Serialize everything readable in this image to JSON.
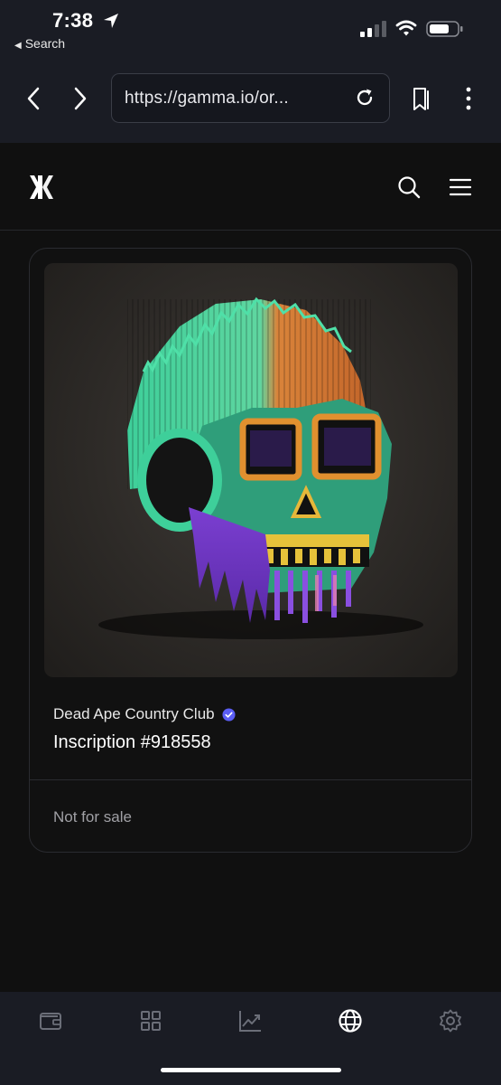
{
  "status_bar": {
    "time": "7:38",
    "back_app": "Search"
  },
  "browser": {
    "url": "https://gamma.io/or..."
  },
  "site": {
    "logo_icon": "gamma-logo-icon"
  },
  "card": {
    "collection": "Dead Ape Country Club",
    "verified": true,
    "title": "Inscription #918558",
    "sale_status": "Not for sale"
  },
  "tab_bar": {
    "tabs": [
      {
        "icon": "wallet-icon",
        "active": false
      },
      {
        "icon": "grid-icon",
        "active": false
      },
      {
        "icon": "chart-icon",
        "active": false
      },
      {
        "icon": "globe-icon",
        "active": true
      },
      {
        "icon": "settings-icon",
        "active": false
      }
    ]
  },
  "colors": {
    "background": "#101010",
    "bar": "#1a1c24",
    "verified": "#5b5ef5",
    "muted_text": "#a0a0a5",
    "inactive_icon": "#6b6e78"
  }
}
